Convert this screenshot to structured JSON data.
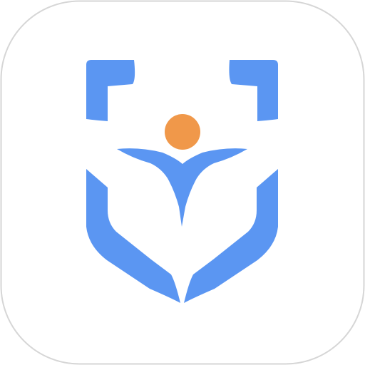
{
  "icon": {
    "name": "shield-person-app-icon",
    "colors": {
      "background": "#ffffff",
      "border": "#d6d6d6",
      "shield": "#5b96f2",
      "head": "#f0984a"
    }
  }
}
